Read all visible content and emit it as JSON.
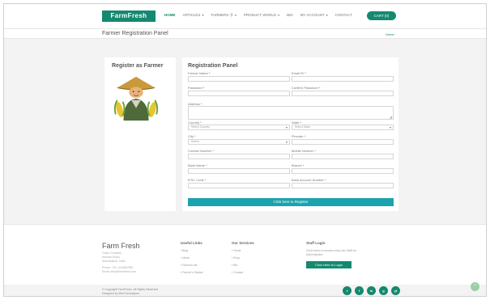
{
  "header": {
    "logo": "FarmFresh",
    "nav": [
      {
        "label": "HOME",
        "active": true,
        "caret": false
      },
      {
        "label": "ARTICLES",
        "caret": true
      },
      {
        "label": "FARMERS Ⓓ",
        "caret": true
      },
      {
        "label": "PRODUCT WORLD",
        "caret": true
      },
      {
        "label": "BID",
        "caret": false
      },
      {
        "label": "MY ACCOUNT",
        "caret": true
      },
      {
        "label": "CONTACT",
        "caret": false
      }
    ],
    "caret_glyph": "▾",
    "cart_label": "CART (0)"
  },
  "subbar": {
    "title": "Farmer Registration Panel",
    "breadcrumb": "Home"
  },
  "left": {
    "title": "Register as Farmer"
  },
  "form": {
    "title": "Registration Panel",
    "fields": {
      "full_name": "Farmer Name",
      "email": "Email ID",
      "password": "Password",
      "confirm_password": "Confirm Password",
      "address": "Address",
      "country": "Country",
      "state": "State",
      "city": "City",
      "pincode": "Pincode",
      "contact": "Contact Number",
      "mobile": "Mobile Number",
      "bank_name": "Bank Name",
      "branch": "Branch",
      "ifsc": "IFSC Code",
      "account": "Bank Account Number"
    },
    "required_mark": "*",
    "country_value": "Select Country",
    "state_value": "Select State",
    "city_value": "Select",
    "submit": "Click here to Register"
  },
  "footer": {
    "brand": "Farm Fresh",
    "address_lines": [
      "Gokul Complex,",
      "Ashram Road,",
      "Ahmedabad, India"
    ],
    "phone": "Phone: +91 1234567890",
    "email": "Email: info@farmfresh.com",
    "col1": {
      "heading": "Useful Links",
      "links": [
        "Blog",
        "News",
        "Farmers list",
        "Farmer's Market"
      ]
    },
    "col2": {
      "heading": "Our Services",
      "links": [
        "Home",
        "Shop",
        "Bid",
        "Contact"
      ]
    },
    "col3": {
      "heading": "Staff Login",
      "text": [
        "Click below to Access entry into Staff as",
        "Administrator"
      ],
      "button": "Click Here to Login"
    },
    "bullet": "›",
    "copyright": "© Copyright FarmFresh. All Rights Reserved",
    "designed": "Designed by Web Developers",
    "social": [
      "t",
      "f",
      "in",
      "g",
      "yt"
    ]
  },
  "scroll_top": "^"
}
